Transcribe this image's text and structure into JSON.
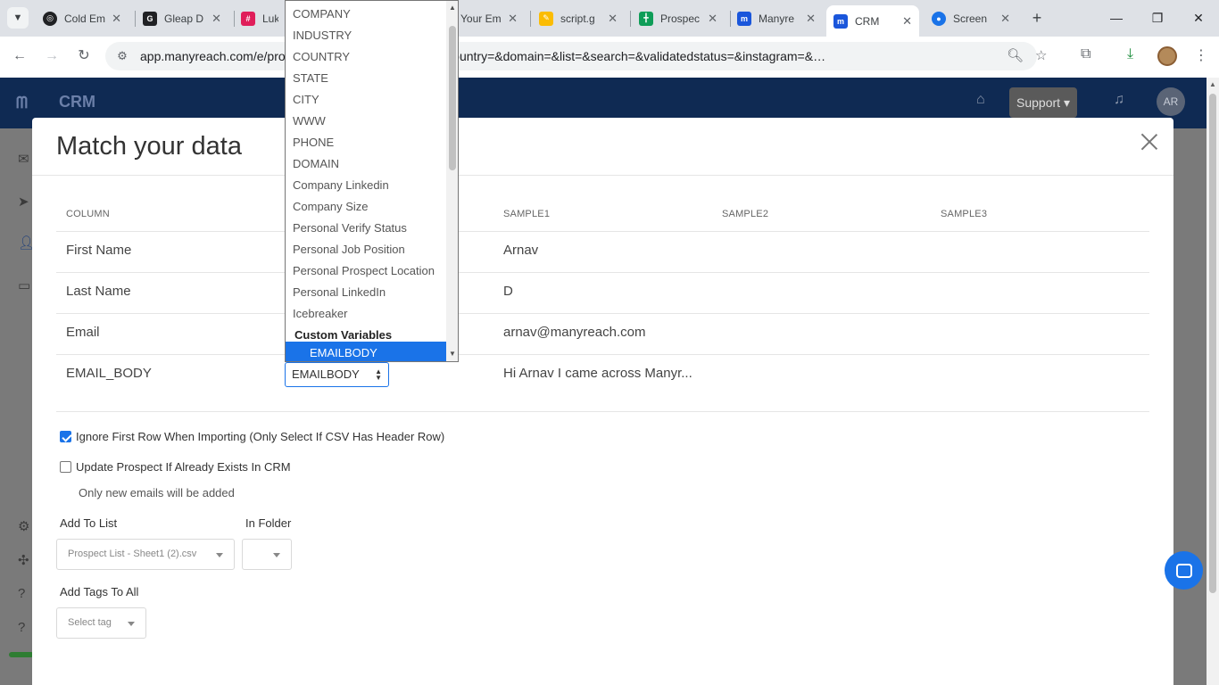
{
  "browser": {
    "tabs": [
      {
        "title": "Cold Em",
        "favicon_color": "#202124"
      },
      {
        "title": "Gleap D",
        "favicon_color": "#202124"
      },
      {
        "title": "Luka",
        "favicon_color": "#e01e5a"
      },
      {
        "title": "Your Em",
        "favicon_color": "#5f6368"
      },
      {
        "title": "script.g",
        "favicon_color": "#fbbc04"
      },
      {
        "title": "Prospec",
        "favicon_color": "#0f9d58"
      },
      {
        "title": "Manyre",
        "favicon_color": "#1a56db"
      },
      {
        "title": "CRM",
        "favicon_color": "#1a56db"
      },
      {
        "title": "Screen",
        "favicon_color": "#1a73e8"
      }
    ],
    "url": "app.manyreach.com/e/pro…mimage=&companysize=&country=&domain=&list=&search=&validatedstatus=&instagram=&…",
    "new_tab": "+",
    "list_tabs_icon": "chevron-down-icon"
  },
  "app": {
    "name": "CRM",
    "support_label": "Support ▾",
    "avatar_initials": "AR"
  },
  "modal": {
    "title": "Match your data",
    "columns": [
      "COLUMN",
      "SAMPLE1",
      "SAMPLE2",
      "SAMPLE3"
    ],
    "rows": [
      {
        "column": "First Name",
        "sample1": "Arnav"
      },
      {
        "column": "Last Name",
        "sample1": "D"
      },
      {
        "column": "Email",
        "sample1": "arnav@manyreach.com"
      },
      {
        "column": "EMAIL_BODY",
        "sample1": "Hi Arnav I came across Manyr..."
      }
    ],
    "mapping_select_value": "EMAILBODY",
    "ignore_first_row": {
      "label": "Ignore First Row When Importing (Only Select If CSV Has Header Row)",
      "checked": true
    },
    "update_prospect": {
      "label": "Update Prospect If Already Exists In CRM",
      "checked": false
    },
    "hint": "Only new emails will be added",
    "add_to_list_label": "Add To List",
    "add_to_list_value": "Prospect List - Sheet1 (2).csv",
    "in_folder_label": "In Folder",
    "in_folder_value": "",
    "add_tags_label": "Add Tags To All",
    "add_tags_placeholder": "Select tag"
  },
  "dropdown": {
    "options": [
      "COMPANY",
      "INDUSTRY",
      "COUNTRY",
      "STATE",
      "CITY",
      "WWW",
      "PHONE",
      "DOMAIN",
      "Company Linkedin",
      "Company Size",
      "Personal Verify Status",
      "Personal Job Position",
      "Personal Prospect Location",
      "Personal LinkedIn",
      "Icebreaker"
    ],
    "group_label": "Custom Variables",
    "selected_option": "EMAILBODY"
  }
}
